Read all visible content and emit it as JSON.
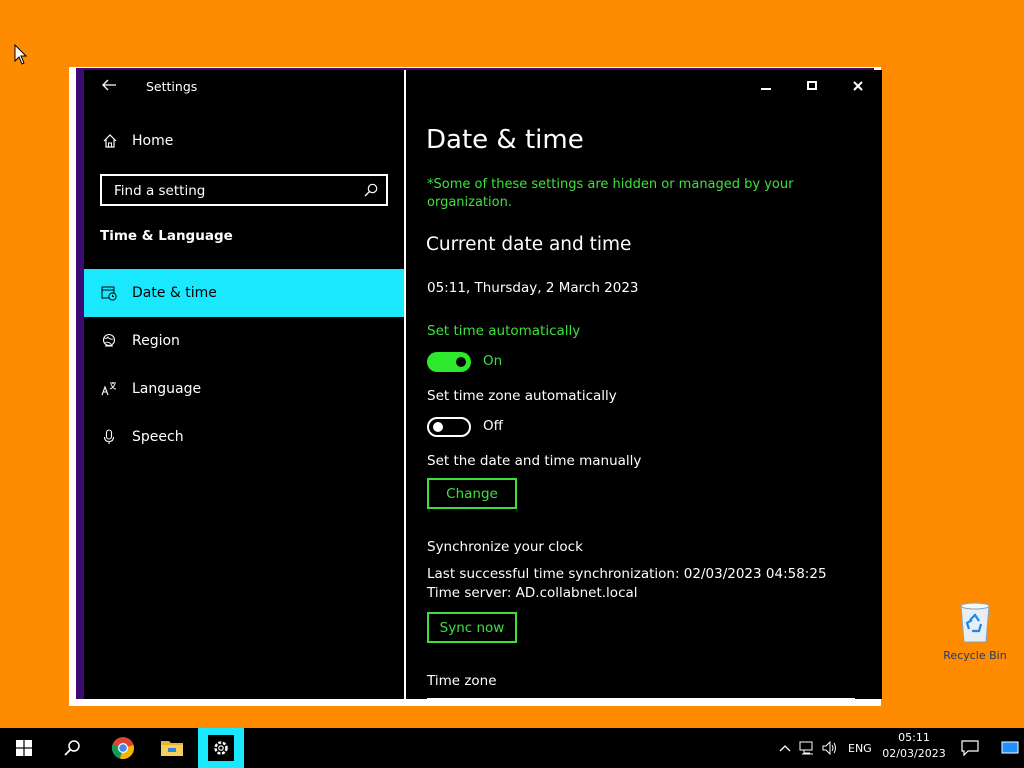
{
  "window": {
    "app_title": "Settings",
    "controls": [
      "minimize",
      "maximize",
      "close"
    ]
  },
  "sidebar": {
    "home_label": "Home",
    "search_placeholder": "Find a setting",
    "section_label": "Time & Language",
    "items": [
      {
        "label": "Date & time",
        "icon": "calendar-clock-icon",
        "active": true
      },
      {
        "label": "Region",
        "icon": "globe-icon",
        "active": false
      },
      {
        "label": "Language",
        "icon": "language-icon",
        "active": false
      },
      {
        "label": "Speech",
        "icon": "microphone-icon",
        "active": false
      }
    ]
  },
  "main": {
    "title": "Date & time",
    "policy_note": "*Some of these settings are hidden or managed by your organization.",
    "current_heading": "Current date and time",
    "current_datetime": "05:11, Thursday, 2 March 2023",
    "set_time_auto": {
      "label": "Set time automatically",
      "state": "On",
      "on": true
    },
    "set_tz_auto": {
      "label": "Set time zone automatically",
      "state": "Off",
      "on": false
    },
    "manual": {
      "label": "Set the date and time manually",
      "button": "Change"
    },
    "sync": {
      "heading": "Synchronize your clock",
      "last_sync": "Last successful time synchronization: 02/03/2023 04:58:25",
      "server": "Time server: AD.collabnet.local",
      "button": "Sync now"
    },
    "timezone_label": "Time zone"
  },
  "desktop": {
    "recycle_bin_label": "Recycle Bin"
  },
  "taskbar": {
    "language": "ENG",
    "time": "05:11",
    "date": "02/03/2023"
  },
  "colors": {
    "desktop": "#ff8c00",
    "accent": "#1ae8ff",
    "green": "#3ee03e",
    "window_bg": "#000000"
  }
}
